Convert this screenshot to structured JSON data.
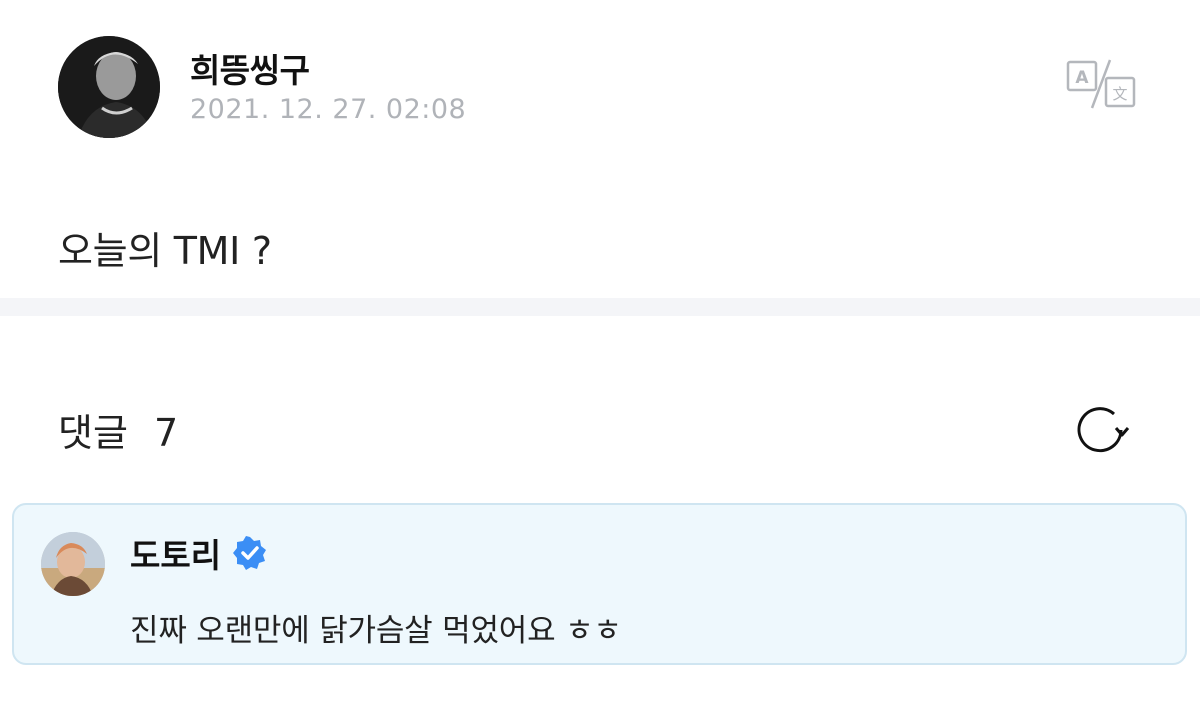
{
  "post": {
    "author": "희뜽씽구",
    "date": "2021. 12. 27. 02:08",
    "body": "오늘의 TMI ?"
  },
  "translate": {
    "icon": "translate-icon"
  },
  "comments": {
    "label": "댓글",
    "count": "7",
    "refresh_icon": "refresh-icon"
  },
  "highlighted_comment": {
    "author": "도토리",
    "verified": true,
    "text": "진짜 오랜만에 닭가슴살 먹었어요 ㅎㅎ"
  },
  "colors": {
    "accent_verified": "#3b8ef5",
    "comment_bg": "#eef8fd",
    "comment_border": "#cfe5f1",
    "date_gray": "#b0b3b8",
    "divider": "#f4f5f8"
  }
}
